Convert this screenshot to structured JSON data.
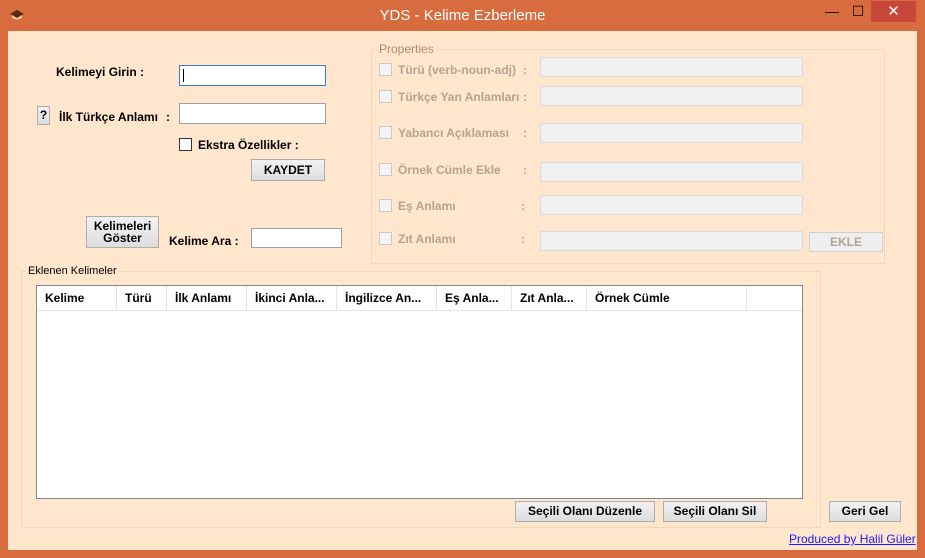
{
  "window": {
    "title": "YDS - Kelime Ezberleme",
    "minimize": "—",
    "maximize": "☐",
    "close": "✕"
  },
  "form": {
    "word_label": "Kelimeyi Girin :",
    "word_value": "",
    "help_button": "?",
    "meaning_label": "İlk Türkçe Anlamı",
    "meaning_colon": ":",
    "meaning_value": "",
    "extra_label": "Ekstra Özellikler :",
    "save_button": "KAYDET",
    "show_words_button": "Kelimeleri Göster",
    "search_label": "Kelime Ara :",
    "search_value": ""
  },
  "properties": {
    "legend": "Properties",
    "rows": [
      {
        "label": "Türü (verb-noun-adj)",
        "colon": ":"
      },
      {
        "label": "Türkçe Yan Anlamları",
        "colon": ":"
      },
      {
        "label": "Yabancı Açıklaması",
        "colon": ":"
      },
      {
        "label": "Örnek Cümle Ekle",
        "colon": ":"
      },
      {
        "label": "Eş Anlamı",
        "colon": ":"
      },
      {
        "label": "Zıt Anlamı",
        "colon": ":"
      }
    ],
    "add_button": "EKLE"
  },
  "words_group": {
    "legend": "Eklenen Kelimeler",
    "columns": [
      "Kelime",
      "Türü",
      "İlk Anlamı",
      "İkinci Anla...",
      "İngilizce An...",
      "Eş Anla...",
      "Zıt Anla...",
      "Örnek Cümle"
    ],
    "rows": []
  },
  "actions": {
    "edit_button": "Seçili Olanı Düzenle",
    "delete_button": "Seçili Olanı Sil",
    "back_button": "Geri Gel"
  },
  "footer": {
    "credit": "Produced by Halil Güler"
  },
  "colors": {
    "titlebar": "#d86c3e",
    "client": "#ffe6cc",
    "close": "#c7483a"
  }
}
